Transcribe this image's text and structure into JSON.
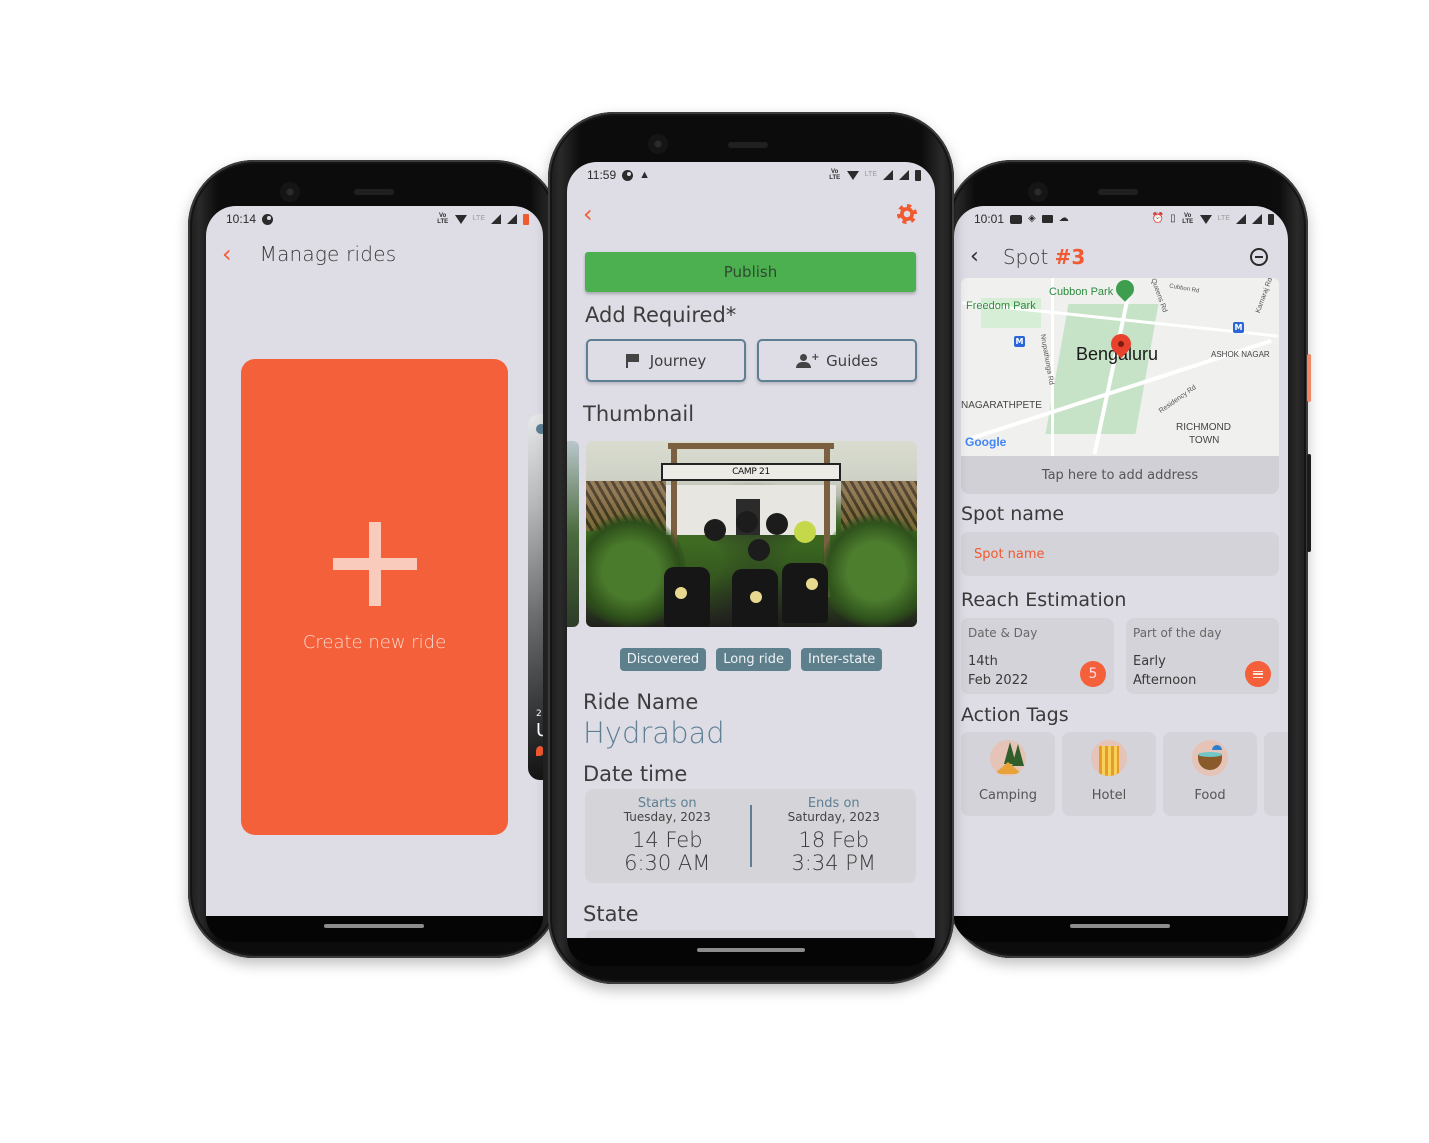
{
  "colors": {
    "accent": "#f15a30",
    "card_orange": "#f4603a",
    "publish_green": "#4caf50",
    "slate_blue": "#5e7f93",
    "screen_bg": "#dedde6"
  },
  "phones": {
    "left": {
      "status_bar": {
        "time": "10:14",
        "left_icons": [
          "data-saver-icon"
        ],
        "right_icons": [
          "volte-icon",
          "wifi-icon",
          "lte-label",
          "signal-icon",
          "signal-icon",
          "battery-low-icon"
        ],
        "lte": "LTE",
        "volte": "Vo)) LTE"
      },
      "header": {
        "back_icon": "chevron-left-icon",
        "title": "Manage rides"
      },
      "create_card": {
        "icon": "plus-icon",
        "label": "Create new ride"
      },
      "peek_card": {
        "small_text": "2",
        "large_text": "U"
      }
    },
    "middle": {
      "status_bar": {
        "time": "11:59",
        "left_icons": [
          "data-saver-icon",
          "warning-icon"
        ],
        "right_icons": [
          "volte-icon",
          "wifi-icon",
          "lte-label",
          "signal-icon",
          "signal-icon",
          "battery-icon"
        ],
        "lte": "LTE",
        "volte": "Vo)) LTE"
      },
      "topbar": {
        "back_icon": "chevron-left-icon",
        "settings_icon": "gear-icon"
      },
      "publish_label": "Publish",
      "add_required": {
        "heading": "Add Required*",
        "buttons": [
          {
            "label": "Journey",
            "icon": "flag-icon"
          },
          {
            "label": "Guides",
            "icon": "add-person-icon"
          }
        ]
      },
      "thumbnail": {
        "heading": "Thumbnail",
        "sign_text": "CAMP 21"
      },
      "tags": [
        "Discovered",
        "Long ride",
        "Inter-state"
      ],
      "ride_name": {
        "heading": "Ride Name",
        "value": "Hydrabad"
      },
      "date_time": {
        "heading": "Date time",
        "start": {
          "label": "Starts on",
          "day": "Tuesday, 2023",
          "date": "14  Feb",
          "time": "6:30 AM"
        },
        "end": {
          "label": "Ends on",
          "day": "Saturday, 2023",
          "date": "18  Feb",
          "time": "3:34  PM"
        }
      },
      "state": {
        "heading": "State"
      }
    },
    "right": {
      "status_bar": {
        "time": "10:01",
        "left_icons": [
          "youtube-icon",
          "location-icon",
          "gallery-icon",
          "cloud-icon"
        ],
        "right_icons": [
          "alarm-icon",
          "vibrate-icon",
          "volte-icon",
          "wifi-icon",
          "lte-label",
          "signal-icon",
          "signal-icon",
          "battery-icon"
        ],
        "lte": "LTE",
        "volte": "Vo)) LTE"
      },
      "header": {
        "back_icon": "chevron-left-icon",
        "title_prefix": "Spot ",
        "title_number": "#3",
        "remove_icon": "minus-circle-icon"
      },
      "map": {
        "city": "Bengaluru",
        "labels": [
          "Cubbon Park",
          "Freedom Park",
          "Queens Rd",
          "Cubbon Rd",
          "Kamaraj Rd",
          "Nrupathunga Rd",
          "ASHOK NAGAR",
          "NAGARATHPETE",
          "Residency Rd",
          "RICHMOND",
          "TOWN"
        ],
        "attribution": "Google"
      },
      "address_prompt": "Tap here to add address",
      "spot_name": {
        "heading": "Spot name",
        "placeholder": "Spot name"
      },
      "reach_estimation": {
        "heading": "Reach  Estimation",
        "date_day": {
          "label": "Date &  Day",
          "line1": "14th",
          "line2": "Feb 2022",
          "badge": "5"
        },
        "part_of_day": {
          "label": "Part of the day",
          "line1": "Early",
          "line2": "Afternoon",
          "badge_icon": "menu-icon"
        }
      },
      "action_tags": {
        "heading": "Action Tags",
        "items": [
          {
            "label": "Camping",
            "icon": "camping-icon"
          },
          {
            "label": "Hotel",
            "icon": "hotel-icon"
          },
          {
            "label": "Food",
            "icon": "food-icon"
          }
        ]
      }
    }
  }
}
